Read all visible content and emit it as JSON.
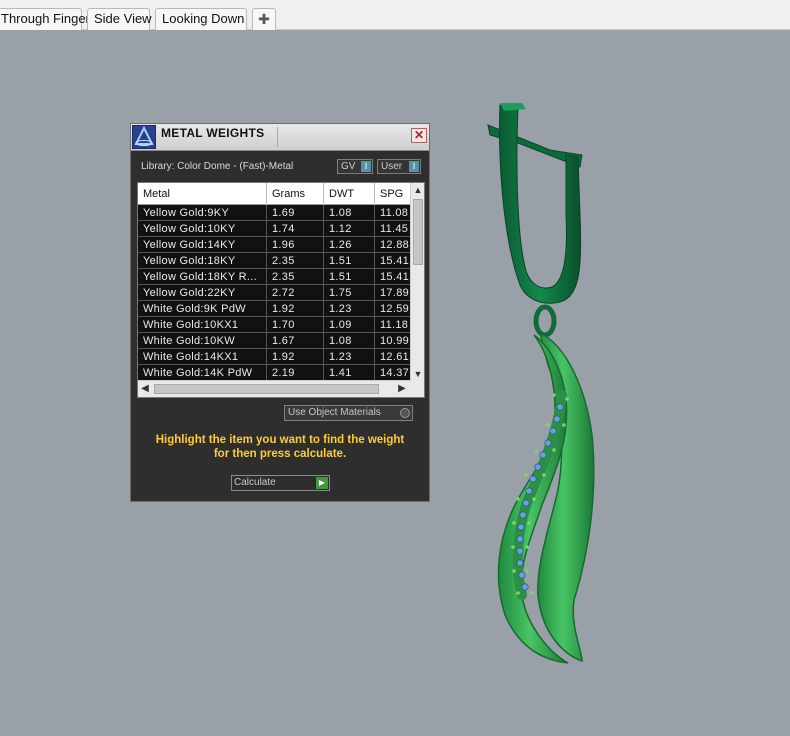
{
  "tabs": [
    {
      "label": "Through Finger"
    },
    {
      "label": "Side View"
    },
    {
      "label": "Looking Down"
    },
    {
      "label": "✚"
    }
  ],
  "dialog": {
    "title": "METAL WEIGHTS",
    "close_glyph": "✕",
    "library_label": "Library: Color Dome - (Fast)-Metal",
    "gv_label": "GV",
    "user_label": "User",
    "toggle_glyph": "I",
    "columns": [
      "Metal",
      "Grams",
      "DWT",
      "SPG"
    ],
    "rows": [
      [
        "Yellow Gold:9KY",
        "1.69",
        "1.08",
        "11.08"
      ],
      [
        "Yellow Gold:10KY",
        "1.74",
        "1.12",
        "11.45"
      ],
      [
        "Yellow Gold:14KY",
        "1.96",
        "1.26",
        "12.88"
      ],
      [
        "Yellow Gold:18KY",
        "2.35",
        "1.51",
        "15.41"
      ],
      [
        "Yellow Gold:18KY R...",
        "2.35",
        "1.51",
        "15.41"
      ],
      [
        "Yellow Gold:22KY",
        "2.72",
        "1.75",
        "17.89"
      ],
      [
        "White Gold:9K PdW",
        "1.92",
        "1.23",
        "12.59"
      ],
      [
        "White Gold:10KX1",
        "1.70",
        "1.09",
        "11.18"
      ],
      [
        "White Gold:10KW",
        "1.67",
        "1.08",
        "10.99"
      ],
      [
        "White Gold:14KX1",
        "1.92",
        "1.23",
        "12.61"
      ],
      [
        "White Gold:14K PdW",
        "2.19",
        "1.41",
        "14.37"
      ]
    ],
    "use_object_materials": "Use Object Materials",
    "hint_line1": "Highlight the item you want to find the weight",
    "hint_line2": "for then press calculate.",
    "calculate_label": "Calculate",
    "calculate_glyph": "▶"
  },
  "colors": {
    "viewport_bg": "#9aa0a7",
    "dialog_bg": "#2e2e2e",
    "hint_text": "#ffcc33",
    "model_green": "#2fa34e",
    "model_dark_green": "#0f6f3f",
    "gem_blue": "#6aa2d8"
  }
}
